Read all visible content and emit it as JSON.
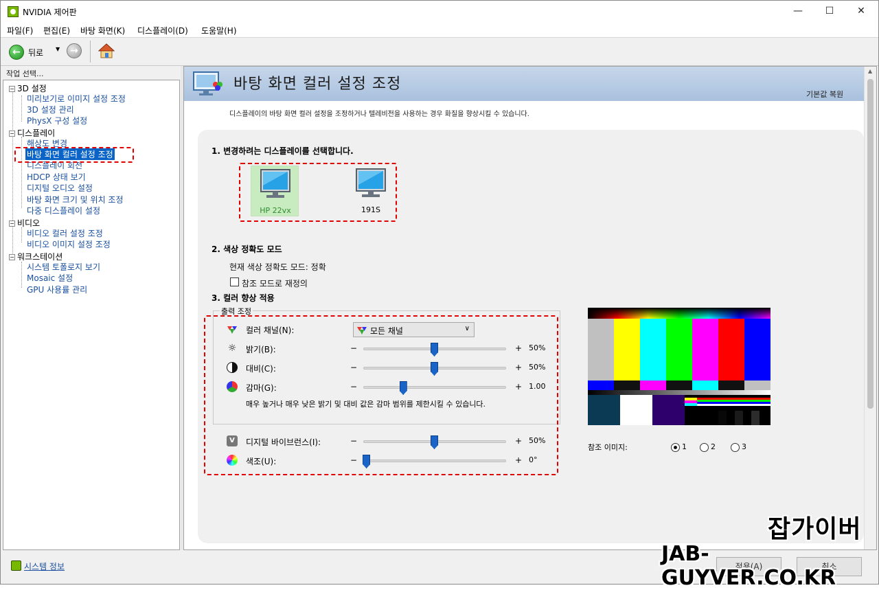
{
  "window": {
    "title": "NVIDIA 제어판"
  },
  "menu": [
    "파일(F)",
    "편집(E)",
    "바탕 화면(K)",
    "디스플레이(D)",
    "도움말(H)"
  ],
  "toolbar": {
    "back_label": "뒤로"
  },
  "left": {
    "header": "작업 선택...",
    "groups": [
      {
        "label": "3D 설정",
        "items": [
          "미리보기로 이미지 설정 조정",
          "3D 설정 관리",
          "PhysX 구성 설정"
        ]
      },
      {
        "label": "디스플레이",
        "items": [
          "해상도 변경",
          "바탕 화면 컬러 설정 조정",
          "디스플레이 회전",
          "HDCP 상태 보기",
          "디지털 오디오 설정",
          "바탕 화면 크기 및 위치 조정",
          "다중 디스플레이 설정"
        ]
      },
      {
        "label": "비디오",
        "items": [
          "비디오 컬러 설정 조정",
          "비디오 이미지 설정 조정"
        ]
      },
      {
        "label": "워크스테이션",
        "items": [
          "시스템 토폴로지 보기",
          "Mosaic 설정",
          "GPU 사용률 관리"
        ]
      }
    ],
    "selected_item": "바탕 화면 컬러 설정 조정"
  },
  "page": {
    "title": "바탕 화면 컬러 설정 조정",
    "restore": "기본값 복원",
    "description": "디스플레이의 바탕 화면 컬러 설정을 조정하거나 텔레비전을 사용하는 경우 화질을 향상시킬 수 있습니다.",
    "section1": "1. 변경하려는 디스플레이를 선택합니다.",
    "displays": [
      {
        "label": "HP 22vx",
        "selected": true
      },
      {
        "label": "191S",
        "selected": false
      }
    ],
    "section2": "2. 색상 정확도 모드",
    "current_mode": "현재 색상 정확도 모드: 정확",
    "ref_mode_checkbox": "참조 모드로 재정의",
    "section3": "3. 컬러 향상 적용",
    "output_legend": "출력 조정",
    "channel_label": "컬러 채널(N):",
    "channel_value": "모든 채널",
    "controls": [
      {
        "label": "밝기(B):",
        "value": "50%",
        "level": 0.5,
        "icon": "sun-icon"
      },
      {
        "label": "대비(C):",
        "value": "50%",
        "level": 0.5,
        "icon": "contrast-icon"
      },
      {
        "label": "감마(G):",
        "value": "1.00",
        "level": 0.28,
        "icon": "gamma-icon"
      }
    ],
    "gamma_note": "매우 높거나 매우 낮은 밝기 및 대비 값은 감마 범위를 제한시킬 수 있습니다.",
    "controls2": [
      {
        "label": "디지털 바이브런스(I):",
        "value": "50%",
        "level": 0.5,
        "icon": "vibrance-icon"
      },
      {
        "label": "색조(U):",
        "value": "0°",
        "level": 0.02,
        "icon": "hue-icon"
      }
    ],
    "ref_image_label": "참조 이미지:",
    "ref_image_options": [
      "1",
      "2",
      "3"
    ],
    "ref_image_selected": "1"
  },
  "bottom": {
    "sysinfo": "시스템 정보",
    "apply": "적용(A)",
    "cancel": "취소"
  },
  "watermark": {
    "korean": "잡가이버",
    "url": "JAB-GUYVER.CO.KR"
  },
  "colors": {
    "selection_blue": "#0a64c8",
    "slider_blue": "#1a64c8",
    "highlight_red": "#e00000",
    "banner": "#b4c8e2",
    "nvidia_green": "#76b900"
  }
}
